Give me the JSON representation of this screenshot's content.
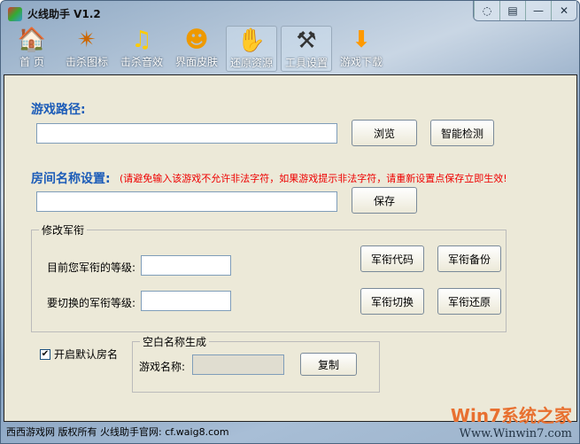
{
  "window": {
    "title": "火线助手 V1.2",
    "controls": [
      "skin",
      "menu",
      "minimize",
      "close"
    ]
  },
  "toolbar": [
    {
      "label": "首 页",
      "icon": "home-icon",
      "glyph": "🏠"
    },
    {
      "label": "击杀图标",
      "icon": "kill-icon-icon",
      "glyph": "✴"
    },
    {
      "label": "击杀音效",
      "icon": "music-note-icon",
      "glyph": "♫"
    },
    {
      "label": "界面皮肤",
      "icon": "skin-icon",
      "glyph": "☻"
    },
    {
      "label": "还原资源",
      "icon": "glove-icon",
      "glyph": "✋"
    },
    {
      "label": "工具设置",
      "icon": "hammer-icon",
      "glyph": "⚒"
    },
    {
      "label": "游戏下载",
      "icon": "download-arrow-icon",
      "glyph": "⬇"
    }
  ],
  "game_path": {
    "label": "游戏路径:",
    "value": "",
    "browse": "浏览",
    "detect": "智能检测"
  },
  "room_name": {
    "label": "房间名称设置:",
    "warning": "(请避免输入该游戏不允许非法字符，如果游戏提示非法字符，请重新设置点保存立即生效!",
    "value": "",
    "save": "保存"
  },
  "rank": {
    "legend": "修改军衔",
    "current_label": "目前您军衔的等级:",
    "target_label": "要切换的军衔等级:",
    "current_value": "",
    "target_value": "",
    "code": "军衔代码",
    "backup": "军衔备份",
    "switch": "军衔切换",
    "restore": "军衔还原"
  },
  "default_room": {
    "label": "开启默认房名",
    "checked": true
  },
  "blank_name": {
    "legend": "空白名称生成",
    "label": "游戏名称:",
    "value": "",
    "copy": "复制"
  },
  "status": {
    "text": "西西游戏网  版权所有  火线助手官网: cf.waig8.com"
  },
  "watermark": {
    "brand": "Win7系统之家",
    "url": "Www.Winwin7.com"
  }
}
